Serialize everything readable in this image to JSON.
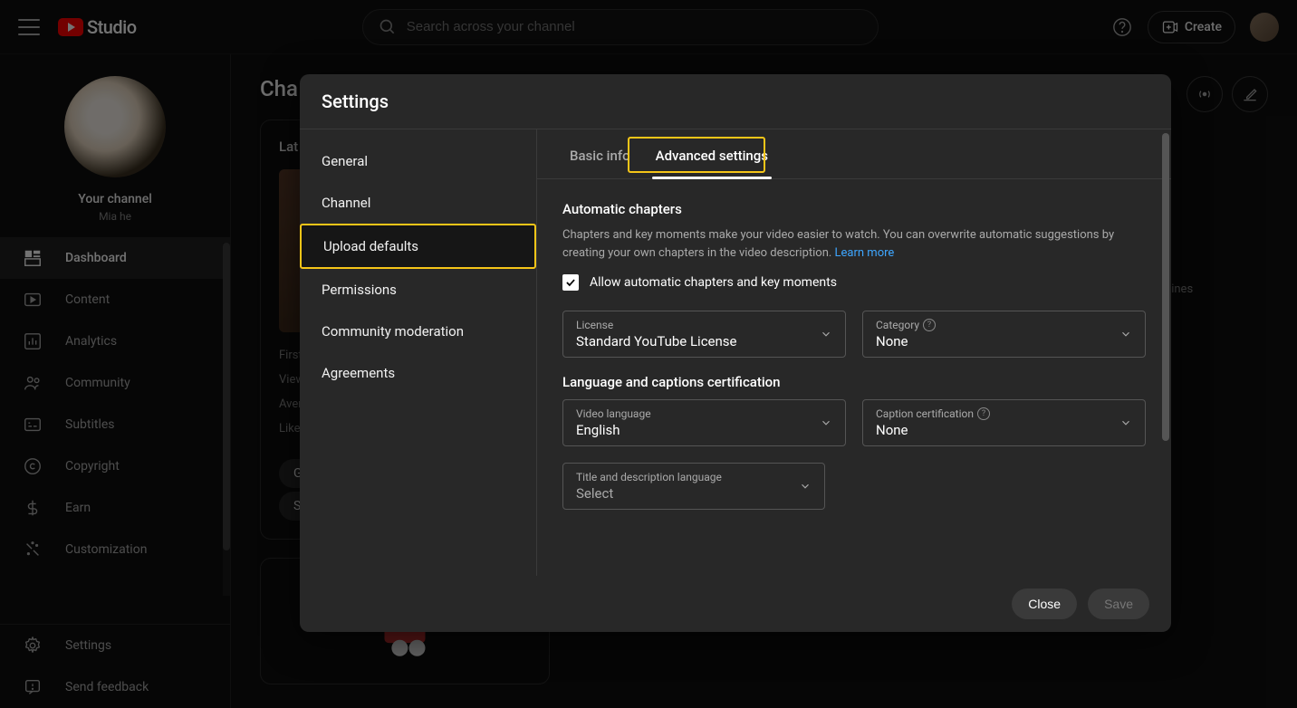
{
  "header": {
    "logo_text": "Studio",
    "search_placeholder": "Search across your channel",
    "create_label": "Create"
  },
  "sidebar": {
    "channel_title": "Your channel",
    "channel_name": "Mia he",
    "items": [
      {
        "label": "Dashboard",
        "active": true
      },
      {
        "label": "Content"
      },
      {
        "label": "Analytics"
      },
      {
        "label": "Community"
      },
      {
        "label": "Subtitles"
      },
      {
        "label": "Copyright"
      },
      {
        "label": "Earn"
      },
      {
        "label": "Customization"
      }
    ],
    "bottom_items": [
      {
        "label": "Settings"
      },
      {
        "label": "Send feedback"
      }
    ]
  },
  "main": {
    "heading_partial": "Cha",
    "card_title_partial": "Lat",
    "stats": [
      "First",
      "View",
      "Aver",
      "Like"
    ],
    "pill1": "G",
    "pill2": "S",
    "guidelines_partial": "lelines"
  },
  "modal": {
    "title": "Settings",
    "nav": [
      {
        "label": "General"
      },
      {
        "label": "Channel"
      },
      {
        "label": "Upload defaults",
        "selected": true
      },
      {
        "label": "Permissions"
      },
      {
        "label": "Community moderation"
      },
      {
        "label": "Agreements"
      }
    ],
    "tabs": [
      {
        "label": "Basic info"
      },
      {
        "label": "Advanced settings",
        "active": true
      }
    ],
    "sections": {
      "auto_chapters": {
        "title": "Automatic chapters",
        "desc": "Chapters and key moments make your video easier to watch. You can overwrite automatic suggestions by creating your own chapters in the video description. ",
        "learn_more": "Learn more",
        "checkbox_label": "Allow automatic chapters and key moments",
        "checked": true
      },
      "license": {
        "label": "License",
        "value": "Standard YouTube License"
      },
      "category": {
        "label": "Category",
        "value": "None"
      },
      "lang_section_title": "Language and captions certification",
      "video_language": {
        "label": "Video language",
        "value": "English"
      },
      "caption_cert": {
        "label": "Caption certification",
        "value": "None"
      },
      "title_desc_lang": {
        "label": "Title and description language",
        "value": "Select"
      }
    },
    "footer": {
      "close": "Close",
      "save": "Save"
    }
  }
}
